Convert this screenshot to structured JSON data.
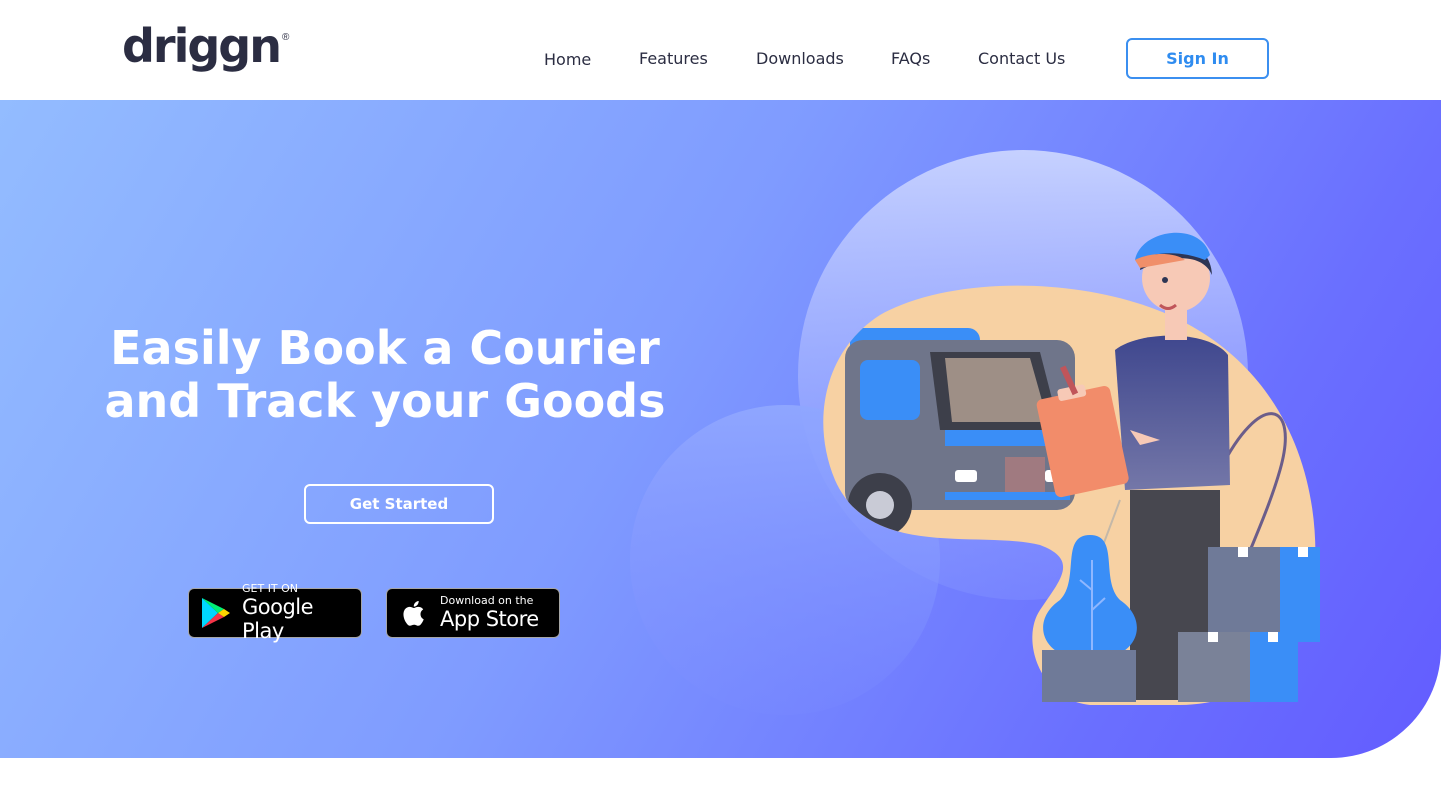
{
  "brand": {
    "name": "driggn",
    "registered_mark": "®"
  },
  "nav": {
    "items": [
      {
        "label": "Home"
      },
      {
        "label": "Features"
      },
      {
        "label": "Downloads"
      },
      {
        "label": "FAQs"
      },
      {
        "label": "Contact Us"
      }
    ],
    "signin_label": "Sign In"
  },
  "hero": {
    "title_line1": "Easily Book a Courier",
    "title_line2": "and Track your Goods",
    "cta_label": "Get Started",
    "badges": {
      "google": {
        "small": "GET IT ON",
        "big": "Google Play",
        "icon": "google-play-icon"
      },
      "apple": {
        "small": "Download on the",
        "big": "App Store",
        "icon": "apple-icon"
      }
    }
  },
  "colors": {
    "accent": "#3b8ff0",
    "text_dark": "#2b2d42",
    "hero_gradient_start": "#93bcff",
    "hero_gradient_end": "#635cff"
  }
}
